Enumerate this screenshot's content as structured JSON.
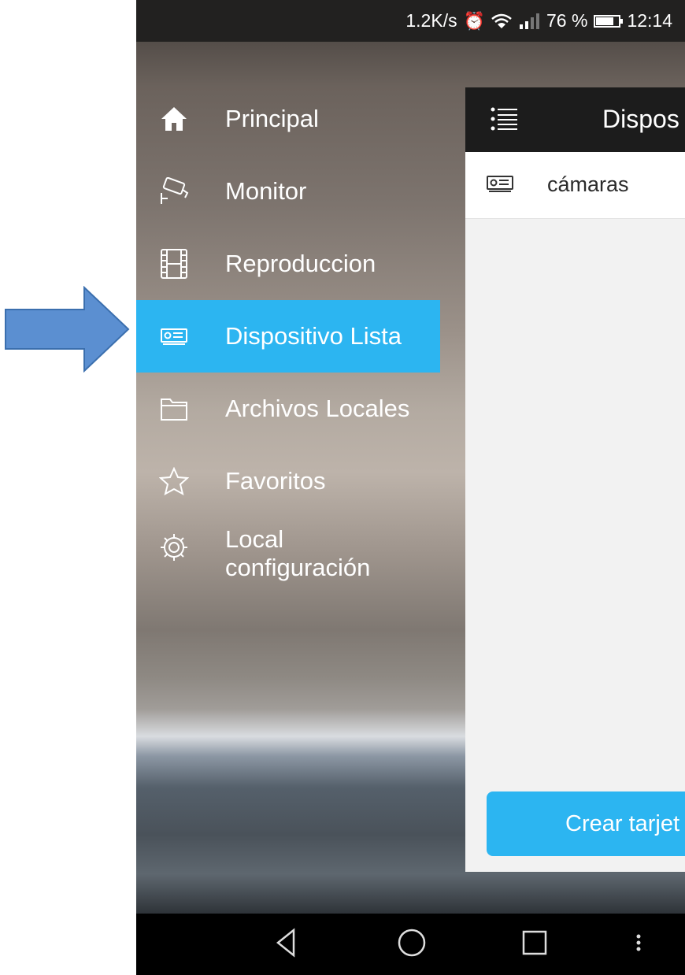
{
  "status_bar": {
    "speed": "1.2K/s",
    "battery": "76 %",
    "time": "12:14",
    "icons": [
      "alarm-icon",
      "wifi-icon",
      "signal-icon",
      "battery-icon"
    ]
  },
  "drawer": {
    "items": [
      {
        "label": "Principal",
        "icon": "home-icon"
      },
      {
        "label": "Monitor",
        "icon": "camera-icon"
      },
      {
        "label": "Reproduccion",
        "icon": "film-icon"
      },
      {
        "label": "Dispositivo Lista",
        "icon": "device-icon",
        "selected": true
      },
      {
        "label": "Archivos Locales",
        "icon": "folder-icon"
      },
      {
        "label": "Favoritos",
        "icon": "star-icon"
      },
      {
        "label": "Local configuración",
        "line1": "Local",
        "line2": "configuración",
        "icon": "gear-icon"
      }
    ]
  },
  "panel": {
    "title": "Dispos",
    "devices": [
      {
        "name": "cámaras",
        "icon": "device-icon"
      }
    ],
    "create_button_label": "Crear tarjet"
  },
  "colors": {
    "accent": "#2cb5f1",
    "header": "#1c1c1c",
    "pointer_arrow": "#5b8fd1"
  },
  "nav_bar": {
    "icons": [
      "back-icon",
      "home-circle-icon",
      "recents-icon",
      "more-icon"
    ]
  }
}
